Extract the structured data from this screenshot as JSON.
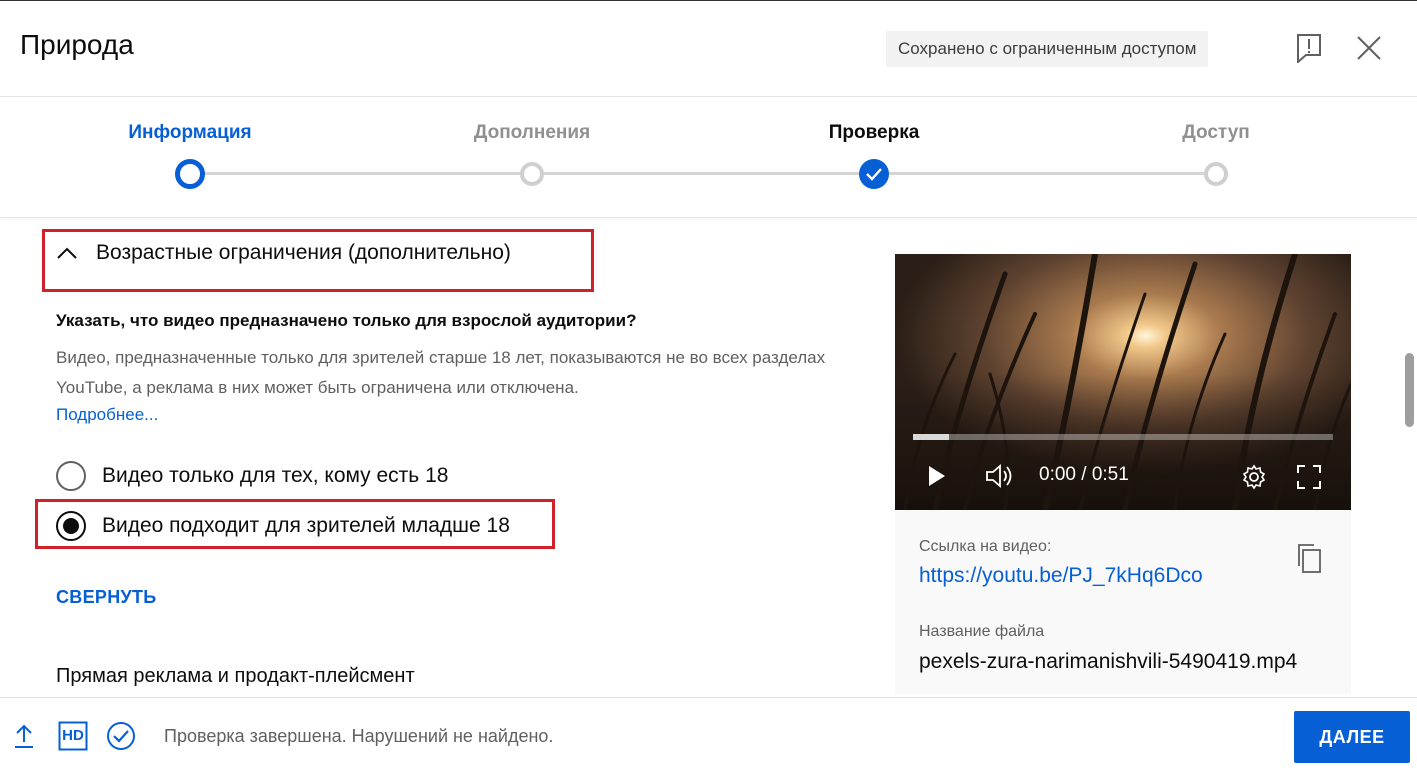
{
  "dialog": {
    "title": "Природа",
    "saved_status": "Сохранено с ограниченным доступом",
    "feedback_icon": "feedback-icon",
    "close_icon": "close-icon"
  },
  "stepper": {
    "steps": [
      {
        "label": "Информация",
        "state": "active"
      },
      {
        "label": "Дополнения",
        "state": "pending"
      },
      {
        "label": "Проверка",
        "state": "done"
      },
      {
        "label": "Доступ",
        "state": "pending"
      }
    ]
  },
  "age_restriction": {
    "section_title": "Возрастные ограничения (дополнительно)",
    "question": "Указать, что видео предназначено только для взрослой аудитории?",
    "description": "Видео, предназначенные только для зрителей старше 18 лет, показываются не во всех разделах YouTube, а реклама в них может быть ограничена или отключена.",
    "learn_more": "Подробнее...",
    "options": [
      {
        "label": "Видео только для тех, кому есть 18",
        "selected": false
      },
      {
        "label": "Видео подходит для зрителей младше 18",
        "selected": true
      }
    ],
    "collapse_label": "СВЕРНУТЬ"
  },
  "next_section_title": "Прямая реклама и продакт-плейсмент",
  "video": {
    "time": "0:00 / 0:51",
    "progress_fraction": 0.085,
    "link_label": "Ссылка на видео:",
    "link": "https://youtu.be/PJ_7kHq6Dco",
    "filename_label": "Название файла",
    "filename": "pexels-zura-narimanishvili-5490419.mp4"
  },
  "footer": {
    "status": "Проверка завершена. Нарушений не найдено.",
    "next_button": "ДАЛЕЕ",
    "hd_label": "HD"
  },
  "colors": {
    "accent": "#065fd4",
    "highlight": "#d0212a"
  }
}
